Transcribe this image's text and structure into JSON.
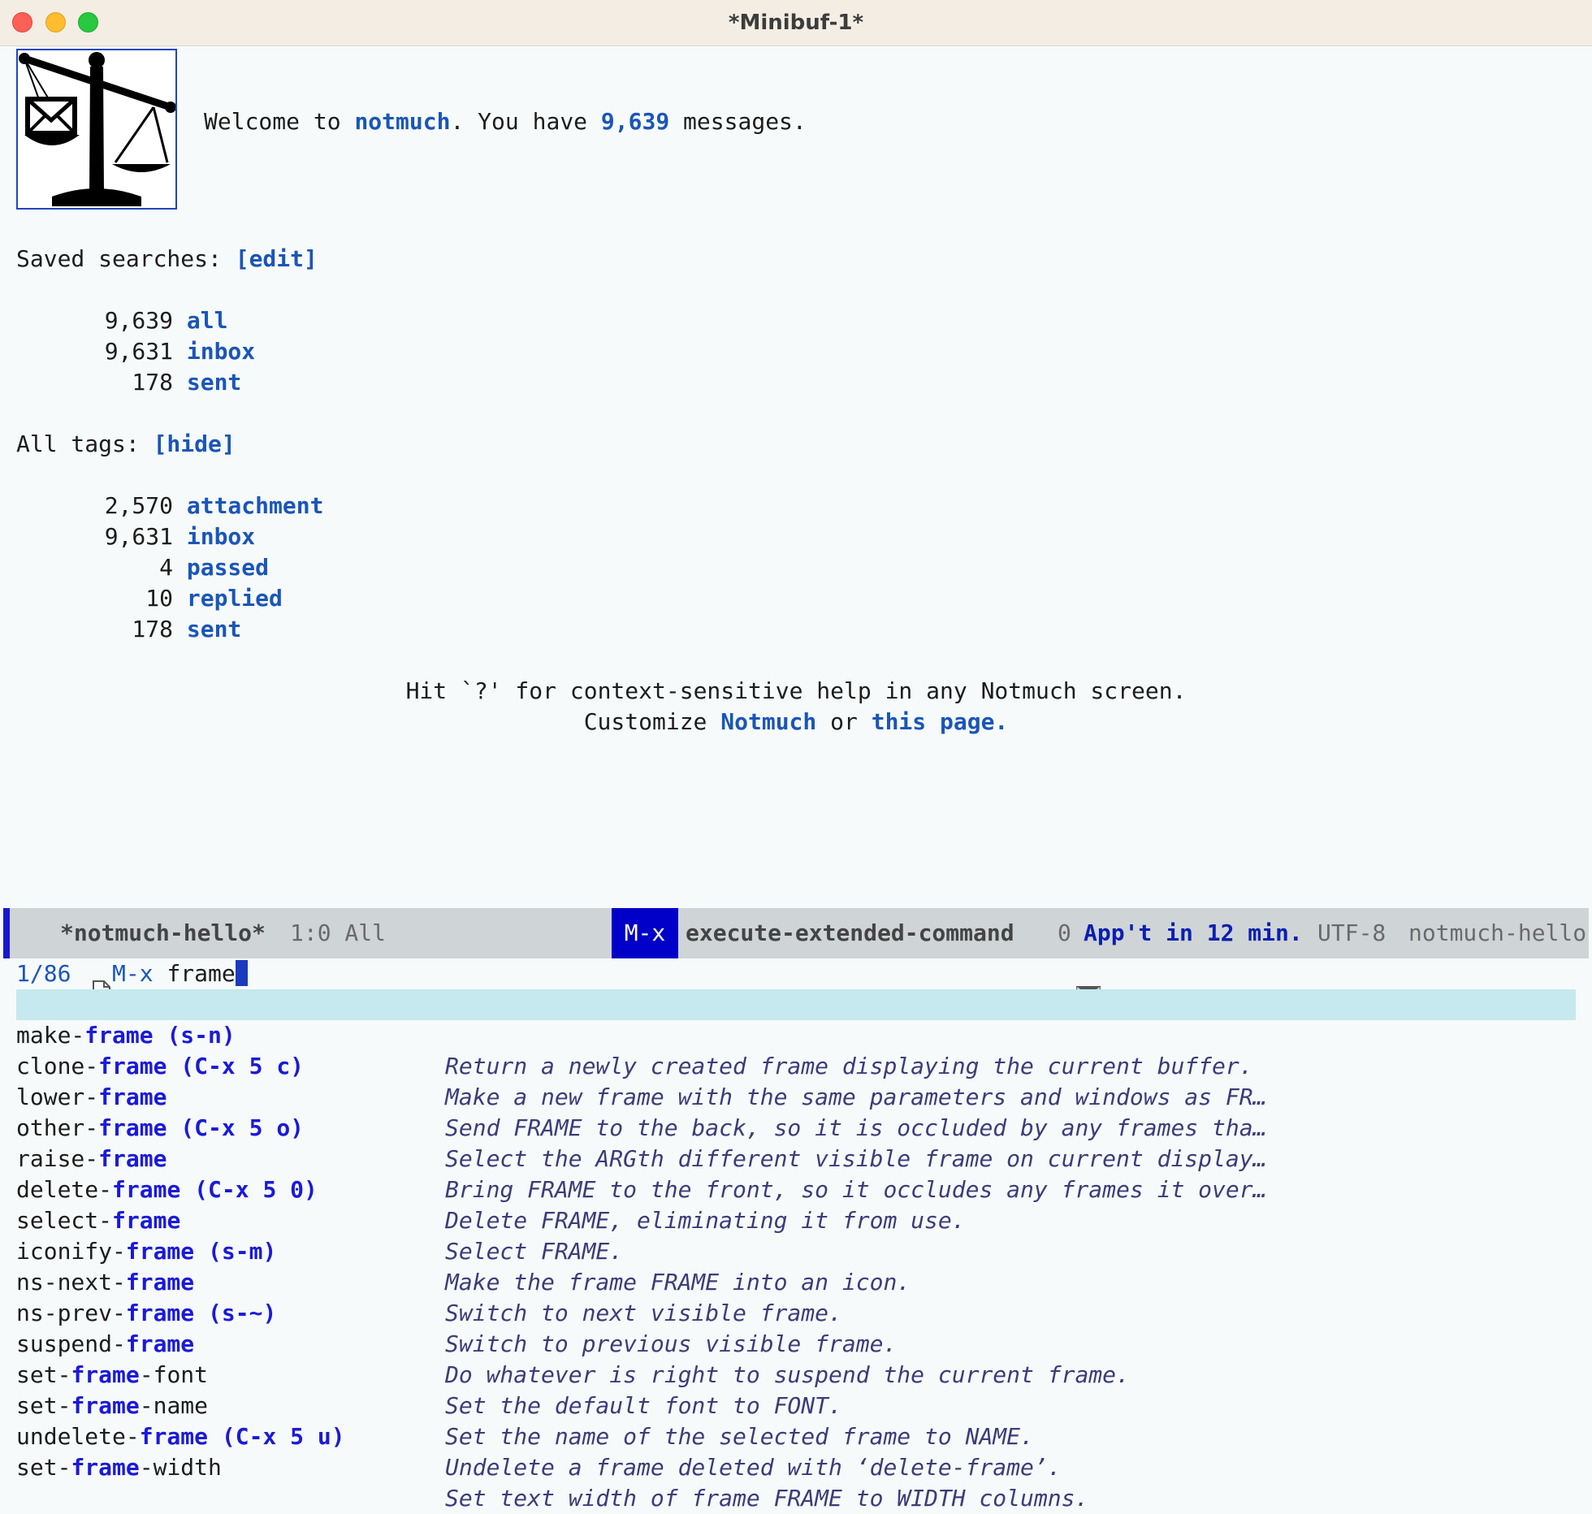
{
  "window": {
    "title": "*Minibuf-1*"
  },
  "hello": {
    "welcome_prefix": "Welcome to ",
    "app_name": "notmuch",
    "welcome_mid": ". You have ",
    "message_count": "9,639",
    "welcome_suffix": " messages.",
    "saved_label": "Saved searches: ",
    "saved_edit": "[edit]",
    "saved": [
      {
        "count": "9,639",
        "name": "all"
      },
      {
        "count": "9,631",
        "name": "inbox"
      },
      {
        "count": "178",
        "name": "sent"
      }
    ],
    "tags_label": "All tags: ",
    "tags_hide": "[hide]",
    "tags": [
      {
        "count": "2,570",
        "name": "attachment"
      },
      {
        "count": "9,631",
        "name": "inbox"
      },
      {
        "count": "4",
        "name": "passed"
      },
      {
        "count": "10",
        "name": "replied"
      },
      {
        "count": "178",
        "name": "sent"
      }
    ],
    "help_line": "Hit `?' for context-sensitive help in any Notmuch screen.",
    "customize_prefix": "Customize ",
    "customize_link1": "Notmuch",
    "customize_mid": " or ",
    "customize_link2": "this page."
  },
  "modeline": {
    "buffer": "*notmuch-hello*",
    "position": "1:0 All",
    "key": "M-x",
    "command": "execute-extended-command",
    "mail_count": "0",
    "appointment": "App't in 12 min.",
    "encoding": "UTF-8",
    "mode": "notmuch-hello"
  },
  "minibuffer": {
    "count": "1/86",
    "prompt": "M-x",
    "input": "frame"
  },
  "candidates": [
    {
      "pre": "make-",
      "match": "frame",
      "post": "",
      "key": " (s-n)",
      "desc": "Return a newly created frame displaying the current buffer."
    },
    {
      "pre": "clone-",
      "match": "frame",
      "post": "",
      "key": " (C-x 5 c)",
      "desc": "Make a new frame with the same parameters and windows as FR…"
    },
    {
      "pre": "lower-",
      "match": "frame",
      "post": "",
      "key": "",
      "desc": "Send FRAME to the back, so it is occluded by any frames tha…"
    },
    {
      "pre": "other-",
      "match": "frame",
      "post": "",
      "key": " (C-x 5 o)",
      "desc": "Select the ARGth different visible frame on current display…"
    },
    {
      "pre": "raise-",
      "match": "frame",
      "post": "",
      "key": "",
      "desc": "Bring FRAME to the front, so it occludes any frames it over…"
    },
    {
      "pre": "delete-",
      "match": "frame",
      "post": "",
      "key": " (C-x 5 0)",
      "desc": "Delete FRAME, eliminating it from use."
    },
    {
      "pre": "select-",
      "match": "frame",
      "post": "",
      "key": "",
      "desc": "Select FRAME."
    },
    {
      "pre": "iconify-",
      "match": "frame",
      "post": "",
      "key": " (s-m)",
      "desc": "Make the frame FRAME into an icon."
    },
    {
      "pre": "ns-next-",
      "match": "frame",
      "post": "",
      "key": "",
      "desc": "Switch to next visible frame."
    },
    {
      "pre": "ns-prev-",
      "match": "frame",
      "post": "",
      "key": " (s-~)",
      "desc": "Switch to previous visible frame."
    },
    {
      "pre": "suspend-",
      "match": "frame",
      "post": "",
      "key": "",
      "desc": "Do whatever is right to suspend the current frame."
    },
    {
      "pre": "set-",
      "match": "frame",
      "post": "-font",
      "key": "",
      "desc": "Set the default font to FONT."
    },
    {
      "pre": "set-",
      "match": "frame",
      "post": "-name",
      "key": "",
      "desc": "Set the name of the selected frame to NAME."
    },
    {
      "pre": "undelete-",
      "match": "frame",
      "post": "",
      "key": " (C-x 5 u)",
      "desc": "Undelete a frame deleted with ‘delete-frame’."
    },
    {
      "pre": "set-",
      "match": "frame",
      "post": "-width",
      "key": "",
      "desc": "Set text width of frame FRAME to WIDTH columns."
    }
  ]
}
